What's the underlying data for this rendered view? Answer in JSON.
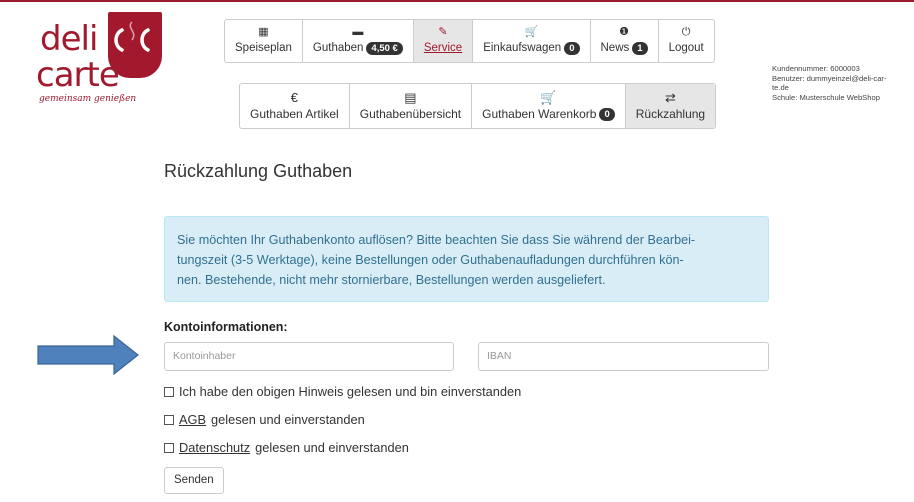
{
  "logo": {
    "word1": "deli",
    "word2": "carte",
    "tagline": "gemeinsam genießen"
  },
  "nav_main": [
    {
      "icon": "▦",
      "label": "Speiseplan"
    },
    {
      "icon": "▬",
      "label": "Guthaben",
      "badge": "4,50 €"
    },
    {
      "icon": "✎",
      "label": "Service"
    },
    {
      "icon": "🛒",
      "label": "Einkaufswagen",
      "badge": "0"
    },
    {
      "icon": "❶",
      "label": "News",
      "badge": "1"
    },
    {
      "icon": "⏻",
      "label": "Logout"
    }
  ],
  "nav_sub": [
    {
      "icon": "€",
      "label": "Guthaben Artikel"
    },
    {
      "icon": "▤",
      "label": "Guthabenübersicht"
    },
    {
      "icon": "🛒",
      "label": "Guthaben Warenkorb",
      "badge": "0"
    },
    {
      "icon": "⇄",
      "label": "Rückzahlung"
    }
  ],
  "user": {
    "customer_no": "Kundennummer: 6000003",
    "user_line1": "Benutzer: dummyeinzel@deli-car-",
    "user_line2": "te.de",
    "school": "Schule: Musterschule WebShop"
  },
  "page": {
    "title": "Rückzahlung Guthaben",
    "alert_line1": "Sie möchten Ihr Guthabenkonto auflösen? Bitte beachten Sie dass Sie während der Bearbei-",
    "alert_line2": "tungszeit (3-5 Werktage), keine Bestellungen oder Guthabenaufladungen durchführen kön-",
    "alert_line3": "nen. Bestehende, nicht mehr stornierbare, Bestellungen werden ausgeliefert.",
    "section_label": "Kontoinformationen:",
    "account_holder_placeholder": "Kontoinhaber",
    "iban_placeholder": "IBAN",
    "check1": "Ich habe den obigen Hinweis gelesen und bin einverstanden",
    "check2_link": "AGB",
    "check2_rest": "gelesen und einverstanden",
    "check3_link": "Datenschutz",
    "check3_rest": "gelesen und einverstanden",
    "submit": "Senden"
  },
  "colors": {
    "brand": "#a2192e",
    "alert_bg": "#d9edf7",
    "alert_text": "#31708f",
    "arrow": "#4f81bd"
  }
}
